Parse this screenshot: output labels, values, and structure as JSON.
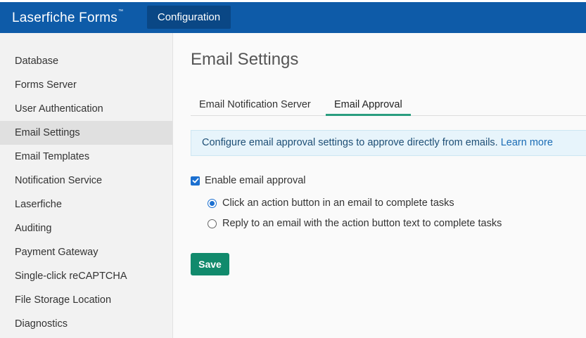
{
  "header": {
    "brand": "Laserfiche Forms",
    "brand_tm": "™",
    "nav_button": "Configuration"
  },
  "sidebar": {
    "items": [
      {
        "label": "Database"
      },
      {
        "label": "Forms Server"
      },
      {
        "label": "User Authentication"
      },
      {
        "label": "Email Settings",
        "active": true
      },
      {
        "label": "Email Templates"
      },
      {
        "label": "Notification Service"
      },
      {
        "label": "Laserfiche"
      },
      {
        "label": "Auditing"
      },
      {
        "label": "Payment Gateway"
      },
      {
        "label": "Single-click reCAPTCHA"
      },
      {
        "label": "File Storage Location"
      },
      {
        "label": "Diagnostics"
      }
    ]
  },
  "main": {
    "title": "Email Settings",
    "tabs": [
      {
        "label": "Email Notification Server",
        "active": false
      },
      {
        "label": "Email Approval",
        "active": true
      }
    ],
    "info": {
      "text": "Configure email approval settings to approve directly from emails.",
      "link": "Learn more"
    },
    "enable_checkbox": {
      "label": "Enable email approval",
      "checked": true
    },
    "options": [
      {
        "label": "Click an action button in an email to complete tasks",
        "selected": true
      },
      {
        "label": "Reply to an email with the action button text to complete tasks",
        "selected": false
      }
    ],
    "save_label": "Save"
  },
  "colors": {
    "header": "#0e5ba8",
    "nav_button": "#0a4785",
    "accent": "#2a9d7f",
    "save": "#118a6c",
    "control": "#1b6fd0"
  }
}
